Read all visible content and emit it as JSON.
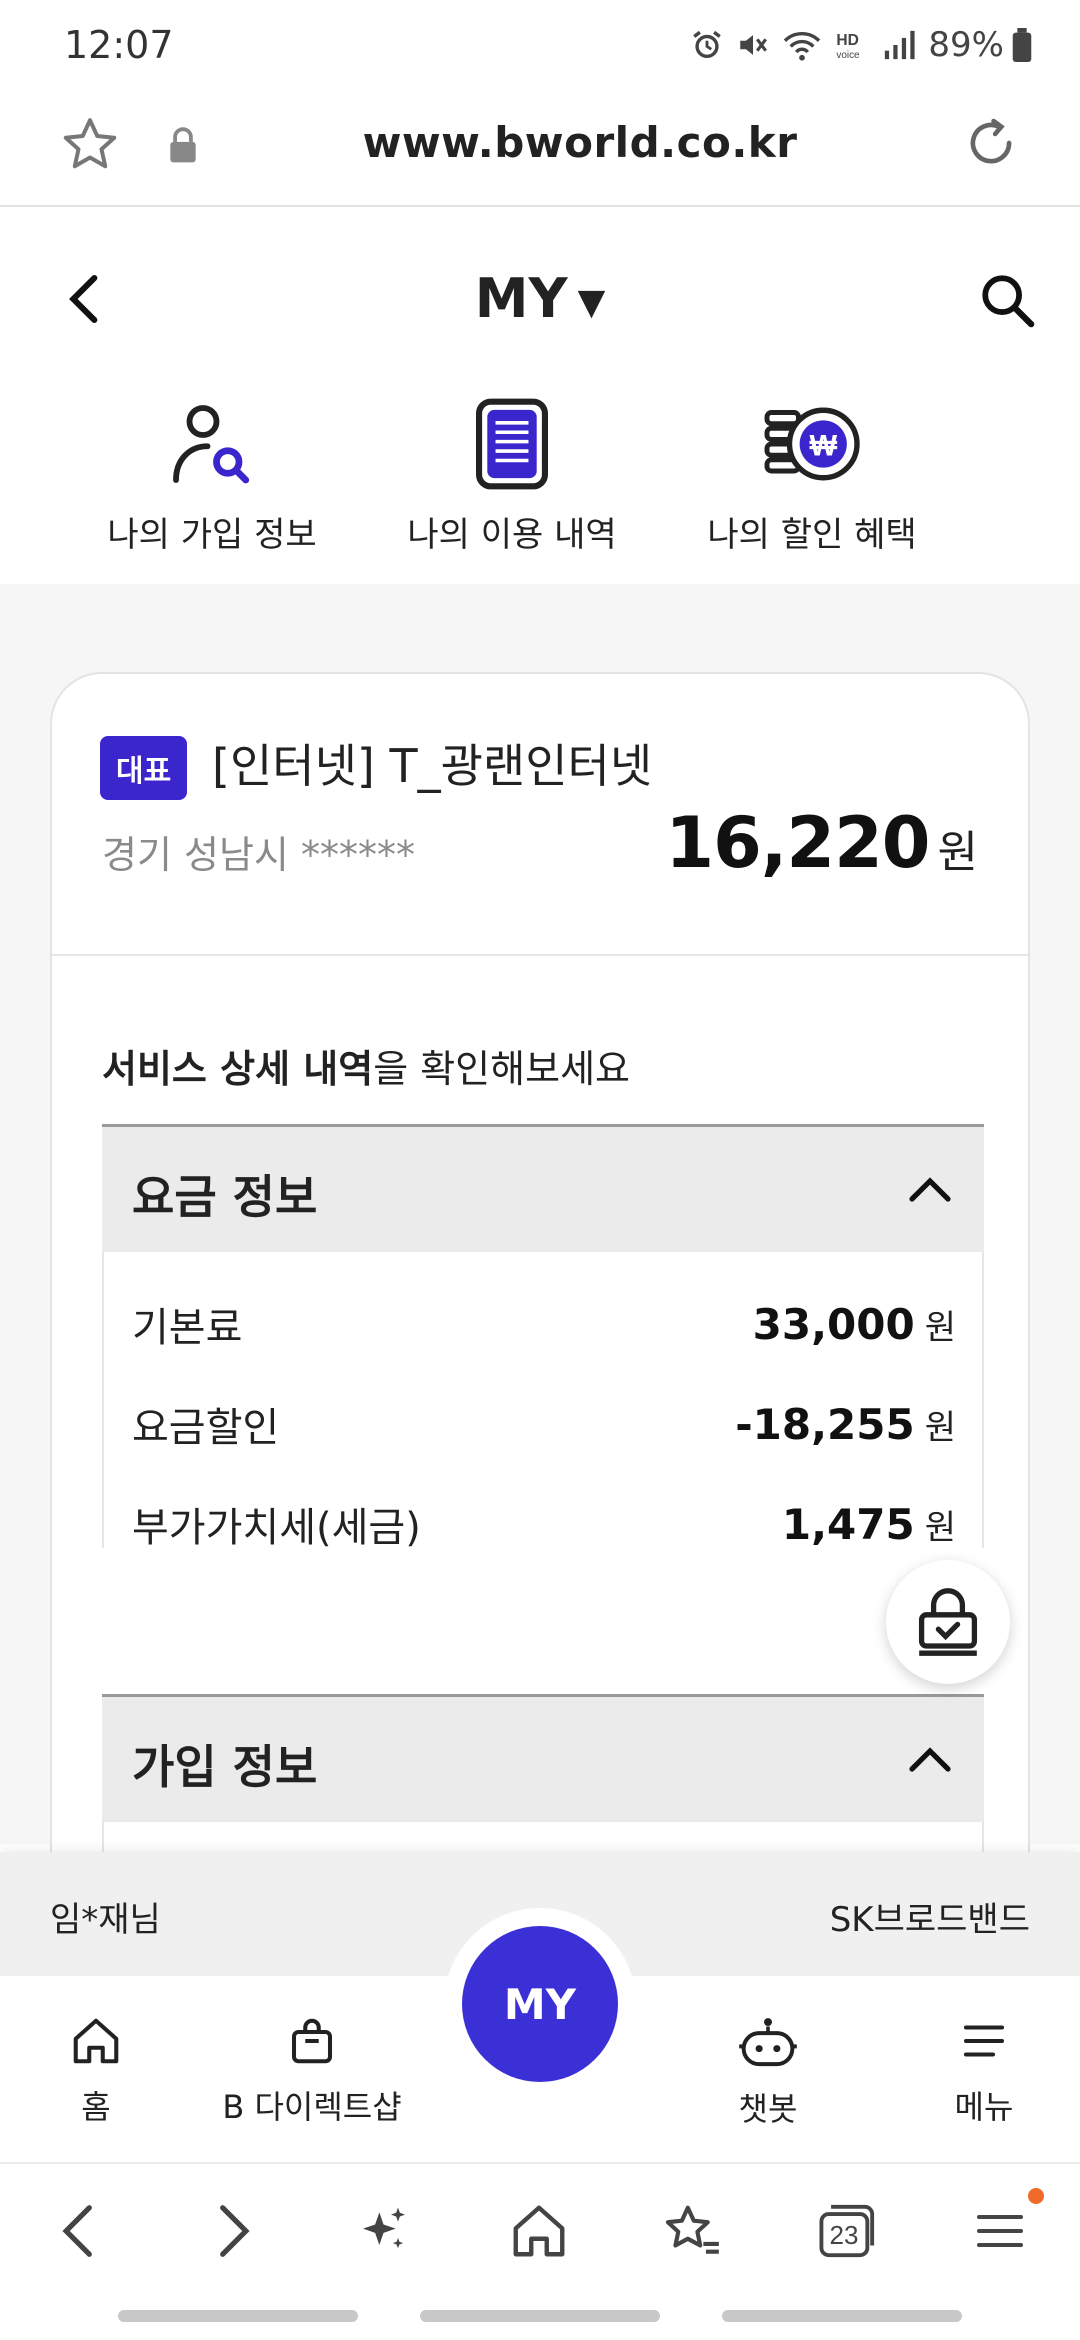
{
  "status_bar": {
    "time": "12:07",
    "battery": "89%"
  },
  "browser": {
    "url": "www.bworld.co.kr",
    "tab_count": "23"
  },
  "header": {
    "title": "MY",
    "caret": "▼",
    "quick_links": [
      {
        "label": "나의 가입 정보",
        "icon": "user-search-icon"
      },
      {
        "label": "나의 이용 내역",
        "icon": "document-list-icon"
      },
      {
        "label": "나의 할인 혜택",
        "icon": "coin-won-icon"
      }
    ]
  },
  "card": {
    "badge": "대표",
    "service_name": "[인터넷] T_광랜인터넷",
    "address": "경기 성남시 ******",
    "amount": "16,220",
    "amount_unit": "원",
    "detail_prompt_bold": "서비스 상세 내역",
    "detail_prompt_rest": "을 확인해보세요"
  },
  "fee_section": {
    "title": "요금 정보",
    "rows": [
      {
        "label": "기본료",
        "value": "33,000",
        "unit": "원"
      },
      {
        "label": "요금할인",
        "value": "-18,255",
        "unit": "원"
      },
      {
        "label": "부가가치세(세금)",
        "value": "1,475",
        "unit": "원"
      }
    ]
  },
  "join_section": {
    "title": "가입 정보"
  },
  "user_bar": {
    "user": "임*재님",
    "company": "SK브로드밴드"
  },
  "site_nav": {
    "home": "홈",
    "shop": "B 다이렉트샵",
    "my": "MY",
    "chatbot": "챗봇",
    "menu": "메뉴"
  },
  "colors": {
    "brand": "#3b2fd6",
    "badge": "#3a26cc",
    "notification": "#f06a2a"
  }
}
